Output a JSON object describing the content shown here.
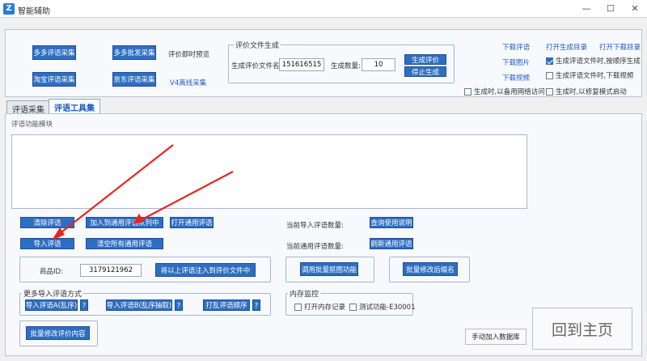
{
  "window": {
    "title": "智能辅助",
    "icon_letter": "Z",
    "min_glyph": "—",
    "max_glyph": "☐",
    "close_glyph": "✕"
  },
  "top": {
    "buttons": {
      "duoduo_collect": "多多评语采集",
      "duoduo_wholesale": "多多批发采集",
      "taobao_collect": "淘宝评语采集",
      "jd_collect": "京东评语采集"
    },
    "preview_label": "评价即时预览",
    "v4_offline_link": "V4离线采集",
    "gen_group": {
      "title": "评价文件生成",
      "filename_label": "生成评价文件名:",
      "filename_value": "151616515",
      "count_label": "生成数量:",
      "count_value": "10",
      "generate_button": "生成评价",
      "stop_button": "停止生成"
    },
    "links": {
      "download_review": "下载评语",
      "open_gen_dir": "打开生成目录",
      "open_download_dir": "打开下载目录",
      "download_images": "下载图片",
      "download_video": "下载视频"
    },
    "checkboxes": {
      "gen_order": {
        "label": "生成评语文件时,按顺序生成",
        "checked": true
      },
      "gen_download_video": {
        "label": "生成评语文件时,下载视频",
        "checked": false
      },
      "gen_backup_network": {
        "label": "生成时,以备用网络访问",
        "checked": false
      },
      "gen_repair_mode": {
        "label": "生成时,以修复模式启动",
        "checked": false
      }
    }
  },
  "tabs": [
    {
      "label": "评语采集",
      "active": false
    },
    {
      "label": "评语工具集",
      "active": true
    }
  ],
  "tool": {
    "module_title": "评语功能模块",
    "buttons": {
      "clear": "清除评语",
      "add_to_queue": "加入到通用评语队列中",
      "open_common": "打开通用评语",
      "import": "导入评语",
      "clear_all_common": "清空所有通用评语"
    },
    "current_import_label": "当前导入评语数量:",
    "view_help_button": "查询使用说明",
    "current_common_label": "当前通用评语数量:",
    "refresh_common_button": "刷新通用评语",
    "product_id_label": "商品ID:",
    "product_id_value": "3179121962",
    "inject_button": "将以上评语注入到评价文件中",
    "batch_image_button": "调用批量抠图功能",
    "batch_rename_button": "批量修改后缀名",
    "more_import": {
      "title": "更多导入评语方式",
      "import_a": "导入评语A(乱序)",
      "import_b": "导入评语B(乱序抽取)",
      "shuffle": "打乱评语顺序",
      "help": "?"
    },
    "memory": {
      "title": "内存监控",
      "open_memory_log": {
        "label": "打开内存记录",
        "checked": false
      },
      "test_feature": {
        "label": "测试功能-E30001",
        "checked": false
      }
    },
    "batch_edit_button": "批量修改评价内容",
    "manual_add_button": "手动加入数据库",
    "back_home_button": "回到主页"
  },
  "colors": {
    "button_blue": "#2e6ec2",
    "link_blue": "#1f5bc4",
    "arrow_red": "#e8261c"
  }
}
